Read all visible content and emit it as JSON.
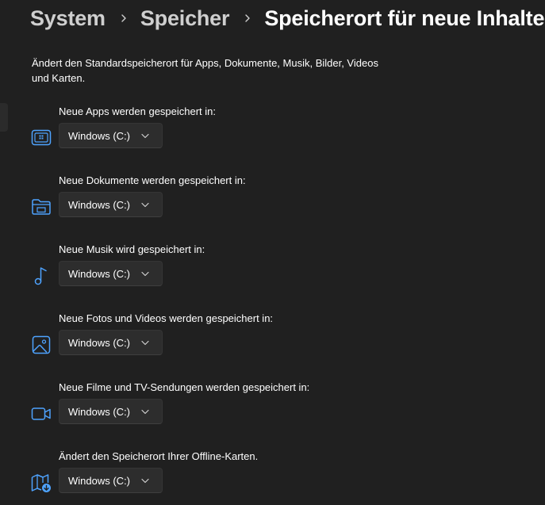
{
  "breadcrumb": {
    "items": [
      "System",
      "Speicher"
    ],
    "current": "Speicherort für neue Inhalte"
  },
  "description": "Ändert den Standardspeicherort für Apps, Dokumente, Musik, Bilder, Videos und Karten.",
  "settings": [
    {
      "label": "Neue Apps werden gespeichert in:",
      "icon": "apps-icon",
      "value": "Windows (C:)"
    },
    {
      "label": "Neue Dokumente werden gespeichert in:",
      "icon": "documents-folder-icon",
      "value": "Windows (C:)"
    },
    {
      "label": "Neue Musik wird gespeichert in:",
      "icon": "music-note-icon",
      "value": "Windows (C:)"
    },
    {
      "label": "Neue Fotos und Videos werden gespeichert in:",
      "icon": "photo-icon",
      "value": "Windows (C:)"
    },
    {
      "label": "Neue Filme und TV-Sendungen werden gespeichert in:",
      "icon": "video-camera-icon",
      "value": "Windows (C:)"
    },
    {
      "label": "Ändert den Speicherort Ihrer Offline-Karten.",
      "icon": "map-download-icon",
      "value": "Windows (C:)"
    }
  ],
  "colors": {
    "background": "#202020",
    "accent_icon": "#4ea3ff",
    "dropdown_bg": "#2d2d2d",
    "breadcrumb_prev": "#cfcfcf"
  }
}
